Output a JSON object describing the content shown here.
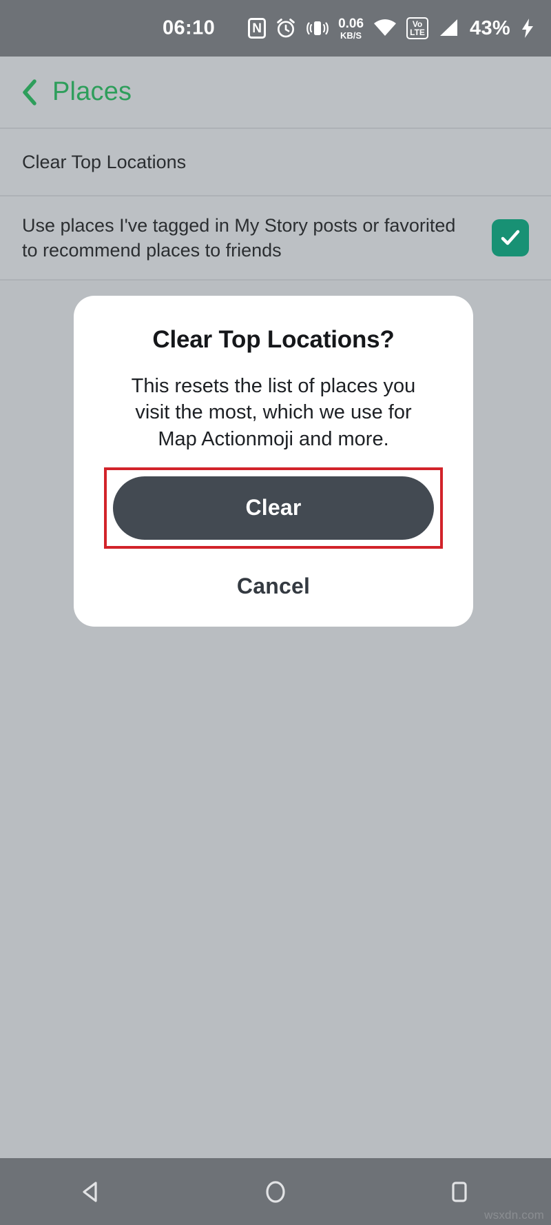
{
  "status_bar": {
    "time": "06:10",
    "nfc_label": "N",
    "data_rate_value": "0.06",
    "data_rate_unit": "KB/S",
    "volte_top": "Vo",
    "volte_bottom": "LTE",
    "battery_percent": "43%",
    "icons": [
      "nfc-icon",
      "alarm-icon",
      "vibrate-icon",
      "data-rate-icon",
      "wifi-icon",
      "volte-icon",
      "signal-icon",
      "battery-charging-icon"
    ],
    "background_color": "#6e7277"
  },
  "header": {
    "title": "Places",
    "back_icon": "chevron-left-icon",
    "title_color": "#2e9e5b"
  },
  "settings": {
    "rows": [
      {
        "label": "Clear Top Locations",
        "has_checkbox": false
      },
      {
        "label": "Use places I've tagged in My Story posts or favorited to recommend places to friends",
        "has_checkbox": true,
        "checked": true
      }
    ],
    "checkbox_color": "#189174"
  },
  "dialog": {
    "title": "Clear Top Locations?",
    "message": "This resets the list of places you visit the most, which we use for Map Actionmoji and more.",
    "primary_button": "Clear",
    "secondary_button": "Cancel",
    "primary_button_color": "#434a52",
    "highlight_color": "#d2232a"
  },
  "nav_bar": {
    "back_icon": "nav-back-triangle-icon",
    "home_icon": "nav-home-circle-icon",
    "recents_icon": "nav-recents-square-icon",
    "background_color": "#6e7277"
  },
  "watermark": {
    "text": "wsxdn.com"
  }
}
